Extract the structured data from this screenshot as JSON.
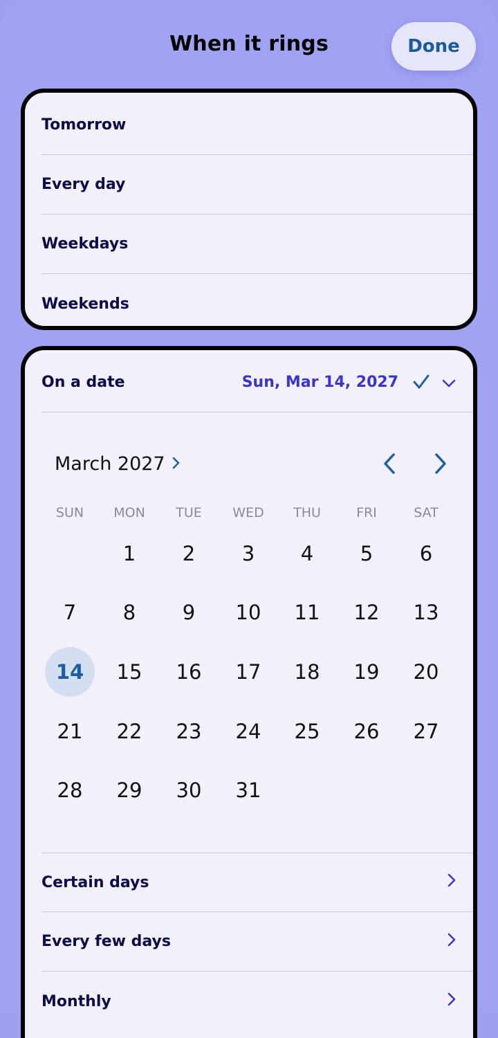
{
  "header": {
    "title": "When it rings",
    "done_label": "Done"
  },
  "presets": [
    {
      "label": "Tomorrow"
    },
    {
      "label": "Every day"
    },
    {
      "label": "Weekdays"
    },
    {
      "label": "Weekends"
    }
  ],
  "on_date": {
    "label": "On a date",
    "value": "Sun, Mar 14, 2027",
    "check_icon": "checkmark-icon",
    "expand_icon": "chevron-down-icon"
  },
  "calendar": {
    "month_label": "March 2027",
    "weekdays": [
      "SUN",
      "MON",
      "TUE",
      "WED",
      "THU",
      "FRI",
      "SAT"
    ],
    "first_weekday_index": 1,
    "days_in_month": 31,
    "selected_day": 14,
    "prev_icon": "chevron-left-icon",
    "next_icon": "chevron-right-icon"
  },
  "more_options": [
    {
      "label": "Certain days"
    },
    {
      "label": "Every few days"
    },
    {
      "label": "Monthly"
    }
  ],
  "colors": {
    "background": "#a0a2f2",
    "card": "#f1f0fb",
    "accent_blue": "#1f5ea0",
    "date_value": "#3b35c9",
    "selected_day_bg": "#d3dff0"
  }
}
